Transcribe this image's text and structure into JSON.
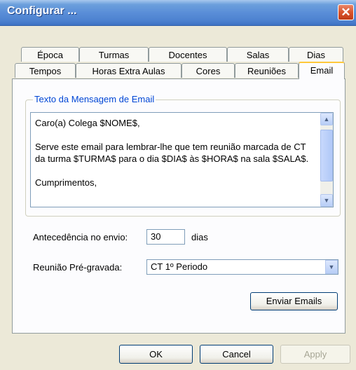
{
  "window": {
    "title": "Configurar ..."
  },
  "tabs_row1": [
    "Época",
    "Turmas",
    "Docentes",
    "Salas",
    "Dias"
  ],
  "tabs_row2": [
    "Tempos",
    "Horas Extra Aulas",
    "Cores",
    "Reuniões",
    "Email"
  ],
  "active_tab": "Email",
  "email": {
    "group_label": "Texto da Mensagem de Email",
    "message": "Caro(a) Colega $NOME$,\n\nServe este email para lembrar-lhe que tem reunião marcada de CT da turma $TURMA$ para o dia $DIA$ às $HORA$ na sala $SALA$.\n\nCumprimentos,",
    "antecedencia_label": "Antecedência no envio:",
    "antecedencia_value": "30",
    "antecedencia_unit": "dias",
    "reuniao_label": "Reunião Pré-gravada:",
    "reuniao_value": "CT 1º Periodo",
    "send_button": "Enviar Emails"
  },
  "buttons": {
    "ok": "OK",
    "cancel": "Cancel",
    "apply": "Apply"
  },
  "icons": {
    "close": "close-icon",
    "scroll_up": "arrow-up-icon",
    "scroll_down": "arrow-down-icon",
    "dropdown": "chevron-down-icon"
  },
  "colors": {
    "title_bar": "#5A8ED8",
    "accent_tab": "#FFC83C",
    "group_label": "#0046D5",
    "dialog_bg": "#ECE9D8"
  }
}
